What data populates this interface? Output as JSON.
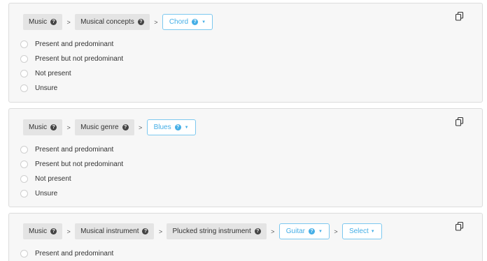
{
  "cards": [
    {
      "crumbs": [
        {
          "label": "Music",
          "help_icon": "question-circle-icon"
        },
        {
          "label": "Musical concepts",
          "help_icon": "question-circle-icon"
        }
      ],
      "dropdowns": [
        {
          "label": "Chord",
          "has_help": true
        }
      ],
      "options": [
        "Present and predominant",
        "Present but not predominant",
        "Not present",
        "Unsure"
      ]
    },
    {
      "crumbs": [
        {
          "label": "Music",
          "help_icon": "question-circle-icon"
        },
        {
          "label": "Music genre",
          "help_icon": "question-circle-icon"
        }
      ],
      "dropdowns": [
        {
          "label": "Blues",
          "has_help": true
        }
      ],
      "options": [
        "Present and predominant",
        "Present but not predominant",
        "Not present",
        "Unsure"
      ]
    },
    {
      "crumbs": [
        {
          "label": "Music",
          "help_icon": "question-circle-icon"
        },
        {
          "label": "Musical instrument",
          "help_icon": "question-circle-icon"
        },
        {
          "label": "Plucked string instrument",
          "help_icon": "question-circle-icon"
        }
      ],
      "dropdowns": [
        {
          "label": "Guitar",
          "has_help": true
        },
        {
          "label": "Select",
          "has_help": false
        }
      ],
      "options": [
        "Present and predominant"
      ]
    }
  ],
  "breadcrumb_separator": ">",
  "icons": {
    "copy": "copy-icon",
    "help": "question-circle-icon",
    "caret": "caret-down-icon"
  },
  "colors": {
    "accent": "#44aee6",
    "card_bg": "#f7f7f7",
    "crumb_bg": "#e4e4e4"
  }
}
